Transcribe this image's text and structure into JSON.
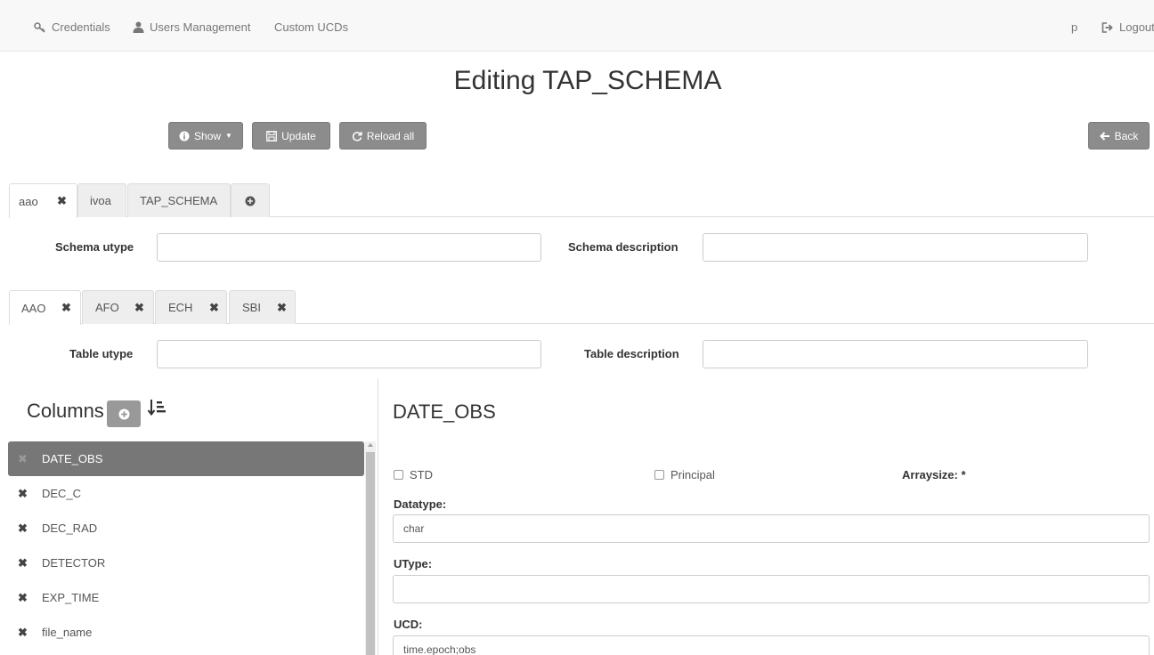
{
  "nav": {
    "credentials": "Credentials",
    "users_management": "Users Management",
    "custom_ucds": "Custom UCDs",
    "user": "p",
    "logout": "Logout"
  },
  "page_title": "Editing TAP_SCHEMA",
  "toolbar": {
    "show": "Show",
    "update": "Update",
    "reload_all": "Reload all",
    "back": "Back"
  },
  "schema_tabs": [
    {
      "label": "aao",
      "active": true,
      "closable": true
    },
    {
      "label": "ivoa",
      "active": false,
      "closable": false
    },
    {
      "label": "TAP_SCHEMA",
      "active": false,
      "closable": false
    }
  ],
  "schema_form": {
    "utype_label": "Schema utype",
    "utype_value": "",
    "description_label": "Schema description",
    "description_value": ""
  },
  "table_tabs": [
    {
      "label": "AAO",
      "active": true
    },
    {
      "label": "AFO",
      "active": false
    },
    {
      "label": "ECH",
      "active": false
    },
    {
      "label": "SBI",
      "active": false
    }
  ],
  "table_form": {
    "utype_label": "Table utype",
    "utype_value": "",
    "description_label": "Table description",
    "description_value": ""
  },
  "columns": {
    "heading": "Columns",
    "items": [
      {
        "name": "DATE_OBS",
        "active": true
      },
      {
        "name": "DEC_C",
        "active": false
      },
      {
        "name": "DEC_RAD",
        "active": false
      },
      {
        "name": "DETECTOR",
        "active": false
      },
      {
        "name": "EXP_TIME",
        "active": false
      },
      {
        "name": "file_name",
        "active": false
      }
    ]
  },
  "detail": {
    "title": "DATE_OBS",
    "std_label": "STD",
    "std_checked": false,
    "principal_label": "Principal",
    "principal_checked": false,
    "arraysize_label": "Arraysize: *",
    "datatype_label": "Datatype:",
    "datatype_value": "char",
    "utype_label": "UType:",
    "utype_value": "",
    "ucd_label": "UCD:",
    "ucd_value": "time.epoch;obs"
  },
  "colors": {
    "button_gray": "#8c8c8c",
    "active_row": "#777777",
    "navbar_bg": "#f8f8f8"
  }
}
